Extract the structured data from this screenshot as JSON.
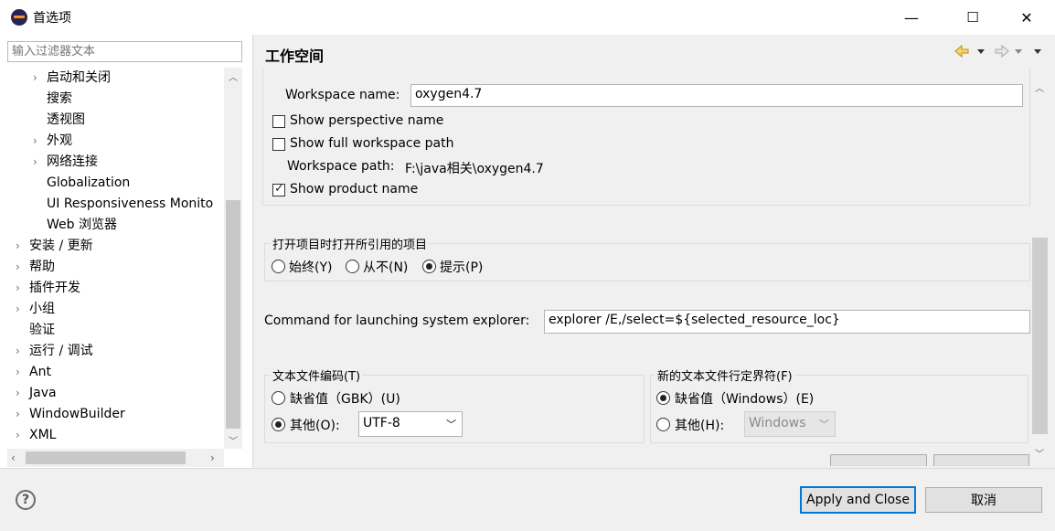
{
  "window": {
    "title": "首选项",
    "minimize_glyph": "—",
    "maximize_glyph": "☐",
    "close_glyph": "✕"
  },
  "filter": {
    "placeholder": "输入过滤器文本"
  },
  "tree": {
    "items": [
      {
        "label": "启动和关闭",
        "expandable": true
      },
      {
        "label": "搜索",
        "expandable": false
      },
      {
        "label": "透视图",
        "expandable": false
      },
      {
        "label": "外观",
        "expandable": true
      },
      {
        "label": "网络连接",
        "expandable": true
      },
      {
        "label": "Globalization",
        "expandable": false
      },
      {
        "label": "UI Responsiveness Monito",
        "expandable": false
      },
      {
        "label": "Web 浏览器",
        "expandable": false
      },
      {
        "label": "安装 / 更新",
        "expandable": true
      },
      {
        "label": "帮助",
        "expandable": true
      },
      {
        "label": "插件开发",
        "expandable": true
      },
      {
        "label": "小组",
        "expandable": true
      },
      {
        "label": "验证",
        "expandable": false
      },
      {
        "label": "运行 / 调试",
        "expandable": true
      },
      {
        "label": "Ant",
        "expandable": true
      },
      {
        "label": "Java",
        "expandable": true
      },
      {
        "label": "WindowBuilder",
        "expandable": true
      },
      {
        "label": "XML",
        "expandable": true
      }
    ]
  },
  "page": {
    "title": "工作空间",
    "workspace_name_label": "Workspace name:",
    "workspace_name_value": "oxygen4.7",
    "show_perspective_name": {
      "label": "Show perspective name",
      "checked": false
    },
    "show_full_workspace_path": {
      "label": "Show full workspace path",
      "checked": false
    },
    "workspace_path_label": "Workspace path:",
    "workspace_path_value": "F:\\java相关\\oxygen4.7",
    "show_product_name": {
      "label": "Show product name",
      "checked": true
    },
    "open_projects_group": {
      "title": "打开项目时打开所引用的项目",
      "options": [
        {
          "label": "始终(Y)",
          "selected": false
        },
        {
          "label": "从不(N)",
          "selected": false
        },
        {
          "label": "提示(P)",
          "selected": true
        }
      ]
    },
    "explorer_command_label": "Command for launching system explorer:",
    "explorer_command_value": "explorer /E,/select=${selected_resource_loc}",
    "encoding_group": {
      "title": "文本文件编码(T)",
      "default_label": "缺省值（GBK）(U)",
      "default_selected": false,
      "other_label": "其他(O):",
      "other_selected": true,
      "other_value": "UTF-8"
    },
    "line_delimiter_group": {
      "title": "新的文本文件行定界符(F)",
      "default_label": "缺省值（Windows）(E)",
      "default_selected": true,
      "other_label": "其他(H):",
      "other_selected": false,
      "other_value": "Windows"
    }
  },
  "buttons": {
    "apply_and_close": "Apply and Close",
    "cancel": "取消"
  },
  "colors": {
    "accent": "#0078d7",
    "window_bg": "#f0f0f0",
    "pane_bg": "#ffffff"
  }
}
